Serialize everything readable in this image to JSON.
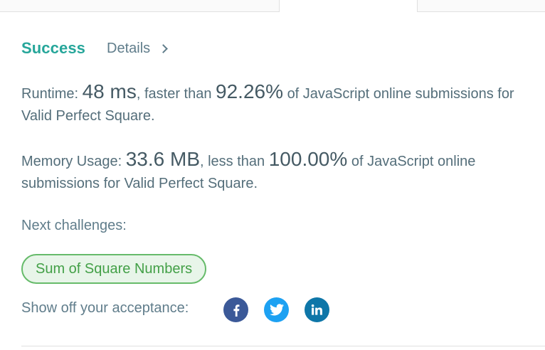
{
  "result": {
    "status": "Success",
    "details_link": "Details"
  },
  "runtime": {
    "label": "Runtime:",
    "value": "48 ms",
    "comparison": ", faster than",
    "percent": "92.26%",
    "suffix": "of JavaScript online submissions for Valid Perfect Square."
  },
  "memory": {
    "label": "Memory Usage:",
    "value": "33.6 MB",
    "comparison": ", less than",
    "percent": "100.00%",
    "suffix": "of JavaScript online submissions for Valid Perfect Square."
  },
  "next_challenges": {
    "label": "Next challenges:",
    "items": [
      "Sum of Square Numbers"
    ]
  },
  "share": {
    "label": "Show off your acceptance:",
    "networks": [
      {
        "icon": "facebook-icon",
        "color": "#3b5998"
      },
      {
        "icon": "twitter-icon",
        "color": "#1da1f2"
      },
      {
        "icon": "linkedin-icon",
        "color": "#0e76a8"
      }
    ]
  },
  "colors": {
    "success": "#26a69a",
    "pill_border": "#66bb6a",
    "pill_bg": "#e8f5e9",
    "pill_text": "#43a047"
  }
}
